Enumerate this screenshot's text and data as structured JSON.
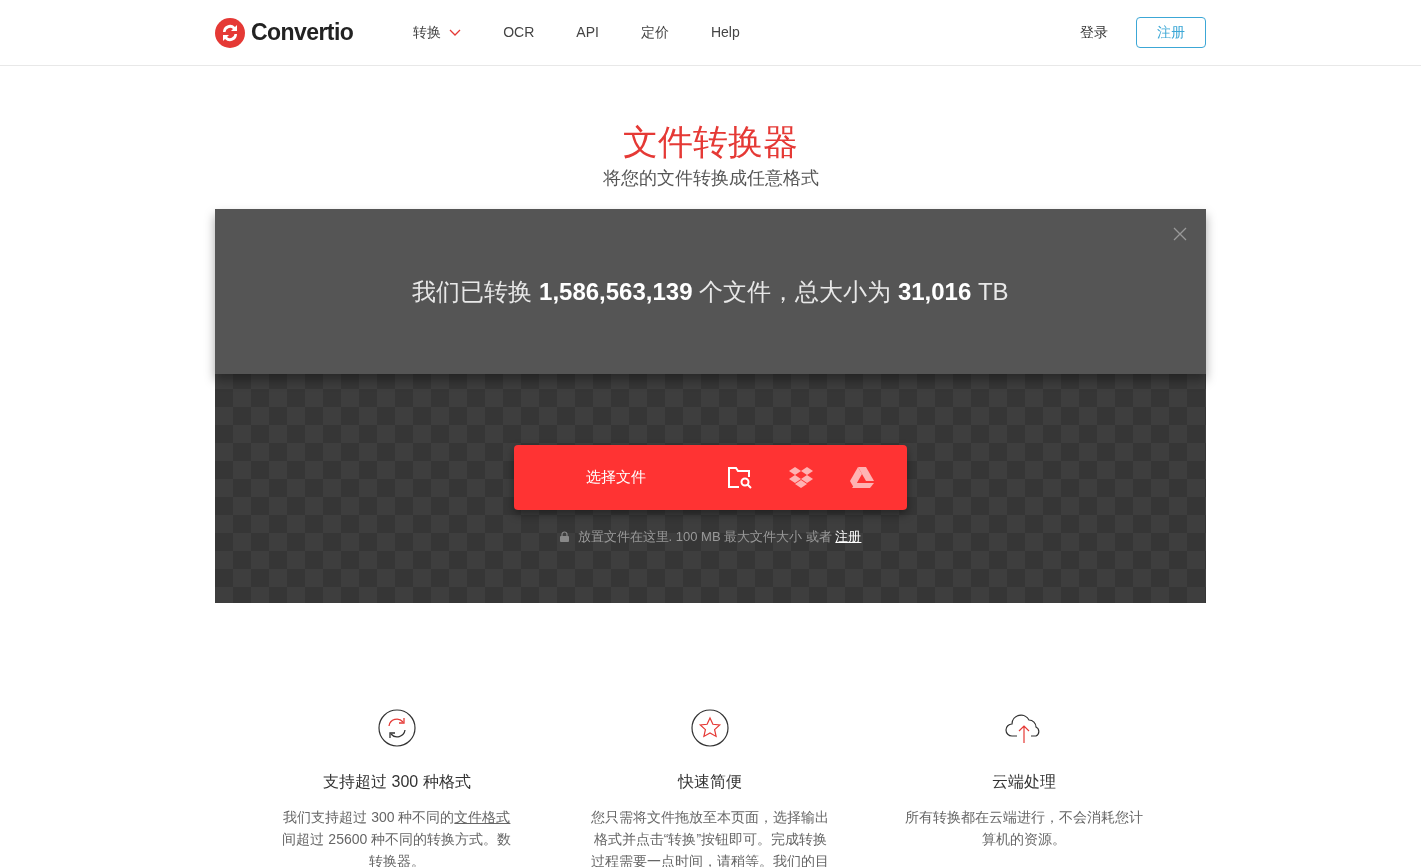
{
  "header": {
    "logo": "Convertio",
    "nav": [
      {
        "label": "转换",
        "kind": "dropdown"
      },
      {
        "label": "OCR",
        "kind": "link"
      },
      {
        "label": "API",
        "kind": "link"
      },
      {
        "label": "定价",
        "kind": "link"
      },
      {
        "label": "Help",
        "kind": "link"
      }
    ],
    "login": "登录",
    "signup": "注册"
  },
  "hero": {
    "title": "文件转换器",
    "subtitle": "将您的文件转换成任意格式"
  },
  "stats": {
    "text": "我们已转换 **1,586,563,139** 个文件，总大小为 **31,016** TB"
  },
  "upload": {
    "button": "选择文件",
    "note": "放置文件在这里. 100 MB 最大文件大小 或者",
    "note_link": "注册"
  },
  "features": [
    {
      "kind": "convert",
      "title": "支持超过 300 种格式",
      "lines": [
        {
          "text": "我们支持超过 300 种不同的",
          "link": "文件格式"
        },
        {
          "text": "间超过 25600 种不同的转换方式。数"
        },
        {
          "text": "转换器。"
        }
      ]
    },
    {
      "kind": "star",
      "title": "快速简便",
      "lines": [
        {
          "text": "您只需将文件拖放至本页面，选择输出"
        },
        {
          "text": "格式并点击“转换”按钮即可。完成转换"
        },
        {
          "text": "过程需要一点时间，请稍等。我们的目"
        }
      ]
    },
    {
      "kind": "cloud",
      "title": "云端处理",
      "lines": [
        {
          "text": "所有转换都在云端进行，不会消耗您计"
        },
        {
          "text": "算机的资源。"
        }
      ]
    }
  ]
}
